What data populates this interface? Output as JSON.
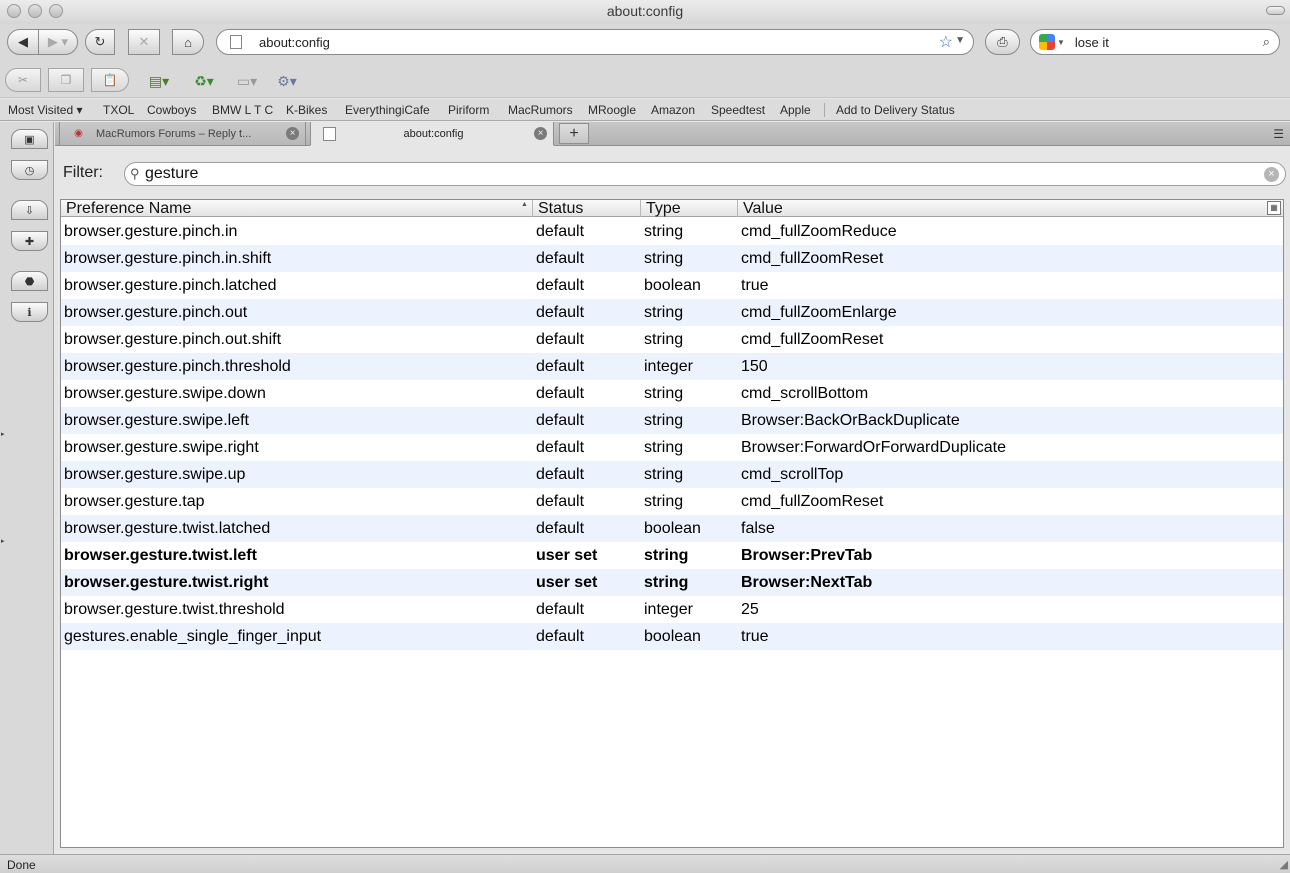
{
  "window": {
    "title": "about:config"
  },
  "nav": {
    "url": "about:config",
    "search_value": "lose it"
  },
  "bookmarks": [
    "Most Visited ▾",
    "TXOL",
    "Cowboys",
    "BMW L T C",
    "K-Bikes",
    "EverythingiCafe",
    "Piriform",
    "MacRumors",
    "MRoogle",
    "Amazon",
    "Speedtest",
    "Apple",
    "Add to Delivery Status"
  ],
  "tabs": [
    {
      "label": "MacRumors Forums – Reply t..."
    },
    {
      "label": "about:config"
    }
  ],
  "filter": {
    "label": "Filter:",
    "value": "gesture"
  },
  "columns": {
    "name": "Preference Name",
    "status": "Status",
    "type": "Type",
    "value": "Value"
  },
  "prefs": [
    {
      "name": "browser.gesture.pinch.in",
      "status": "default",
      "type": "string",
      "value": "cmd_fullZoomReduce"
    },
    {
      "name": "browser.gesture.pinch.in.shift",
      "status": "default",
      "type": "string",
      "value": "cmd_fullZoomReset"
    },
    {
      "name": "browser.gesture.pinch.latched",
      "status": "default",
      "type": "boolean",
      "value": "true"
    },
    {
      "name": "browser.gesture.pinch.out",
      "status": "default",
      "type": "string",
      "value": "cmd_fullZoomEnlarge"
    },
    {
      "name": "browser.gesture.pinch.out.shift",
      "status": "default",
      "type": "string",
      "value": "cmd_fullZoomReset"
    },
    {
      "name": "browser.gesture.pinch.threshold",
      "status": "default",
      "type": "integer",
      "value": "150"
    },
    {
      "name": "browser.gesture.swipe.down",
      "status": "default",
      "type": "string",
      "value": "cmd_scrollBottom"
    },
    {
      "name": "browser.gesture.swipe.left",
      "status": "default",
      "type": "string",
      "value": "Browser:BackOrBackDuplicate"
    },
    {
      "name": "browser.gesture.swipe.right",
      "status": "default",
      "type": "string",
      "value": "Browser:ForwardOrForwardDuplicate"
    },
    {
      "name": "browser.gesture.swipe.up",
      "status": "default",
      "type": "string",
      "value": "cmd_scrollTop"
    },
    {
      "name": "browser.gesture.tap",
      "status": "default",
      "type": "string",
      "value": "cmd_fullZoomReset"
    },
    {
      "name": "browser.gesture.twist.latched",
      "status": "default",
      "type": "boolean",
      "value": "false"
    },
    {
      "name": "browser.gesture.twist.left",
      "status": "user set",
      "type": "string",
      "value": "Browser:PrevTab"
    },
    {
      "name": "browser.gesture.twist.right",
      "status": "user set",
      "type": "string",
      "value": "Browser:NextTab"
    },
    {
      "name": "browser.gesture.twist.threshold",
      "status": "default",
      "type": "integer",
      "value": "25"
    },
    {
      "name": "gestures.enable_single_finger_input",
      "status": "default",
      "type": "boolean",
      "value": "true"
    }
  ],
  "status_bar": {
    "text": "Done"
  }
}
